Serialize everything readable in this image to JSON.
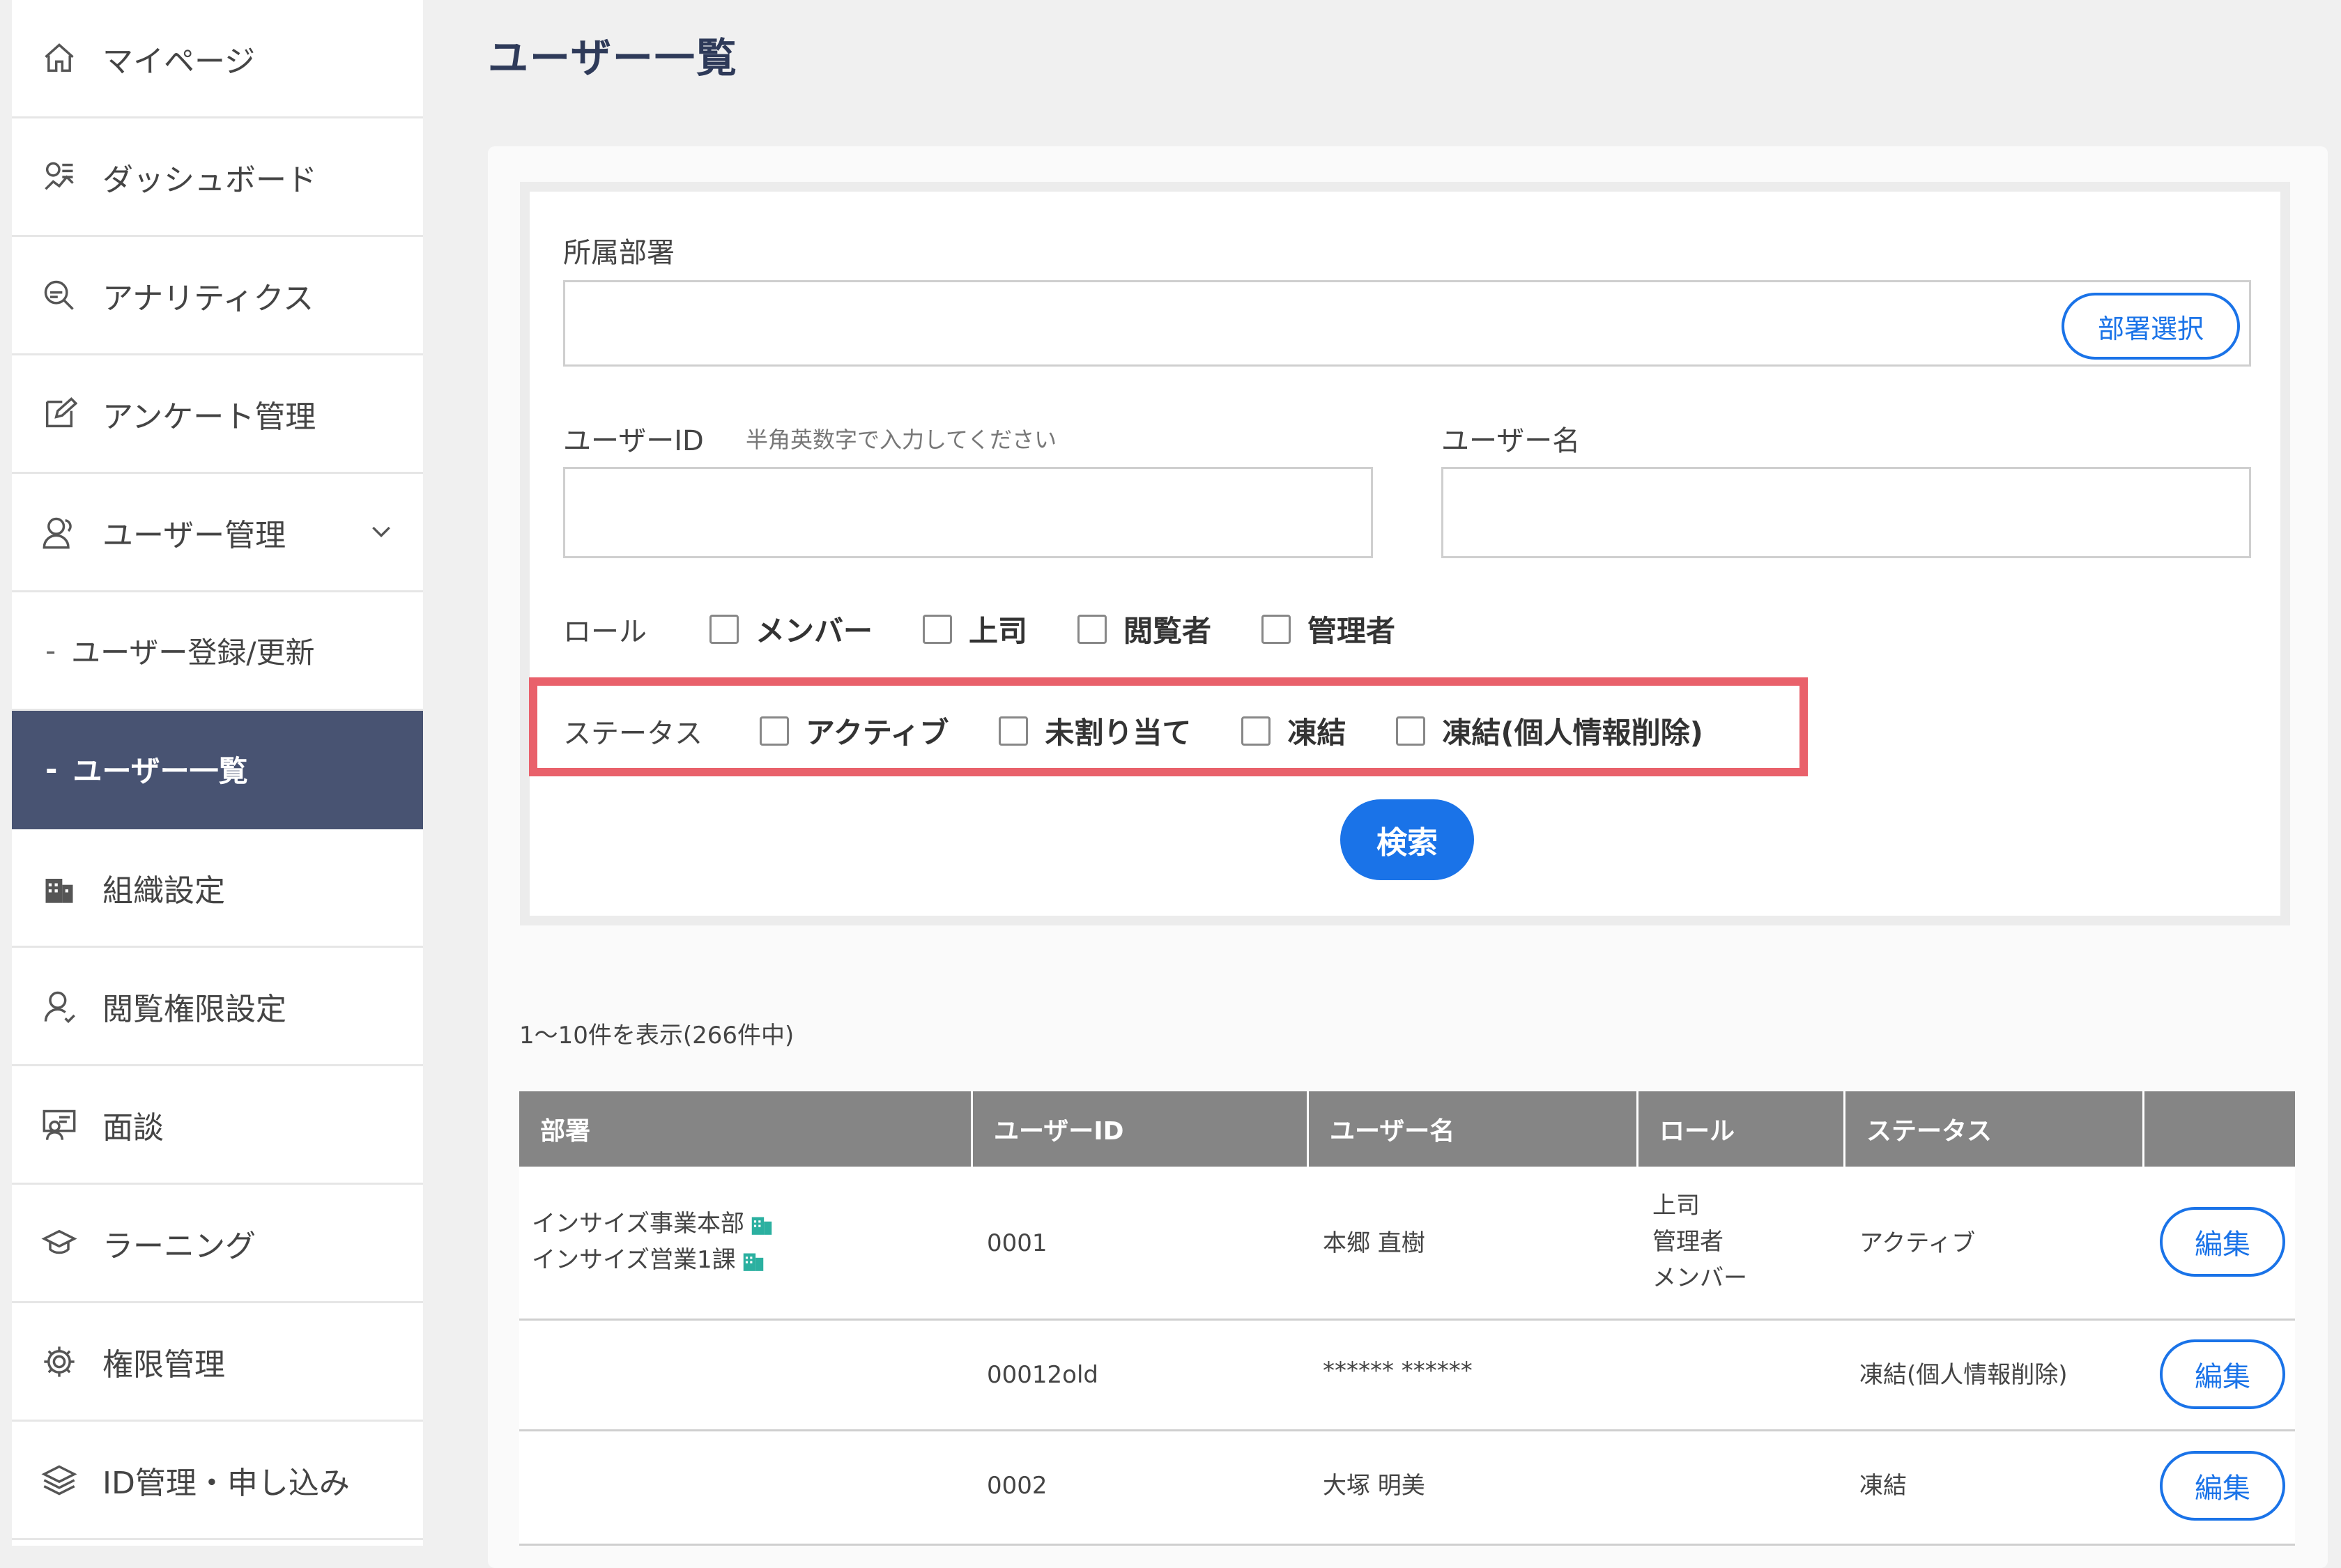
{
  "sidebar": {
    "items": [
      {
        "label": "マイページ",
        "icon": "home-icon"
      },
      {
        "label": "ダッシュボード",
        "icon": "dashboard-icon"
      },
      {
        "label": "アナリティクス",
        "icon": "analytics-search-icon"
      },
      {
        "label": "アンケート管理",
        "icon": "edit-icon"
      },
      {
        "label": "ユーザー管理",
        "icon": "users-icon"
      },
      {
        "label": "ユーザー登録/更新",
        "prefix": "-"
      },
      {
        "label": "ユーザー一覧",
        "prefix": "-"
      },
      {
        "label": "組織設定",
        "icon": "building-icon"
      },
      {
        "label": "閲覧権限設定",
        "icon": "user-permission-icon"
      },
      {
        "label": "面談",
        "icon": "interview-icon"
      },
      {
        "label": "ラーニング",
        "icon": "graduation-cap-icon"
      },
      {
        "label": "権限管理",
        "icon": "gear-icon"
      },
      {
        "label": "ID管理・申し込み",
        "icon": "layers-icon"
      }
    ]
  },
  "page": {
    "title": "ユーザー一覧"
  },
  "search": {
    "department_label": "所属部署",
    "department_button": "部署選択",
    "user_id_label": "ユーザーID",
    "user_id_hint": "半角英数字で入力してください",
    "user_name_label": "ユーザー名",
    "role_label": "ロール",
    "roles": [
      "メンバー",
      "上司",
      "閲覧者",
      "管理者"
    ],
    "status_label": "ステータス",
    "statuses": [
      "アクティブ",
      "未割り当て",
      "凍結",
      "凍結(個人情報削除)"
    ],
    "search_button": "検索"
  },
  "results": {
    "count_text": "1～10件を表示(266件中)"
  },
  "table": {
    "headers": [
      "部署",
      "ユーザーID",
      "ユーザー名",
      "ロール",
      "ステータス",
      ""
    ],
    "edit_label": "編集",
    "rows": [
      {
        "dept": [
          "インサイズ事業本部",
          "インサイズ営業1課"
        ],
        "user_id": "0001",
        "user_name": "本郷 直樹",
        "roles": [
          "上司",
          "管理者",
          "メンバー"
        ],
        "status": "アクティブ"
      },
      {
        "dept": [],
        "user_id": "00012old",
        "user_name": "****** ******",
        "roles": [],
        "status": "凍結(個人情報削除)"
      },
      {
        "dept": [],
        "user_id": "0002",
        "user_name": "大塚 明美",
        "roles": [],
        "status": "凍結"
      }
    ]
  },
  "colors": {
    "accent": "#1a73e8",
    "sidebar_active": "#485372",
    "highlight": "#e9616b",
    "org_icon": "#2bb0a0"
  }
}
